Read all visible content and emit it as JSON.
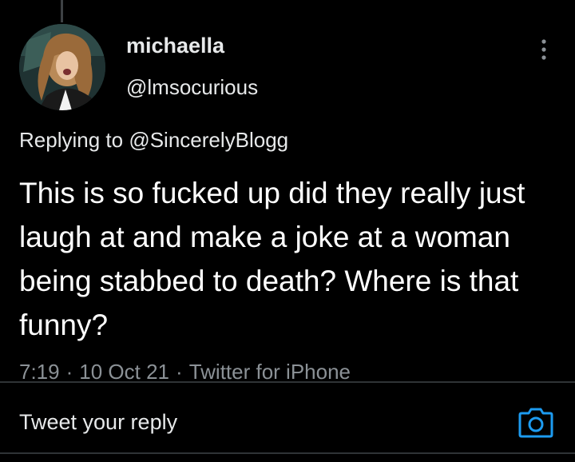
{
  "colors": {
    "background": "#000000",
    "text": "#e7e9ea",
    "muted": "#8b9196",
    "accent": "#1d9bf0",
    "divider": "#2f3336"
  },
  "tweet": {
    "display_name": "michaella",
    "handle": "@lmsocurious",
    "replying_prefix": "Replying to",
    "replying_to": "@SincerelyBlogg",
    "text": "This is so fucked up did they really just laugh at and make a joke at a woman being stabbed to death? Where is that funny?",
    "time": "7:19",
    "date": "10 Oct 21",
    "source": "Twitter for iPhone",
    "separator": "·"
  },
  "icons": {
    "more": "more-vertical-icon",
    "camera": "camera-icon"
  },
  "reply": {
    "placeholder": "Tweet your reply"
  }
}
